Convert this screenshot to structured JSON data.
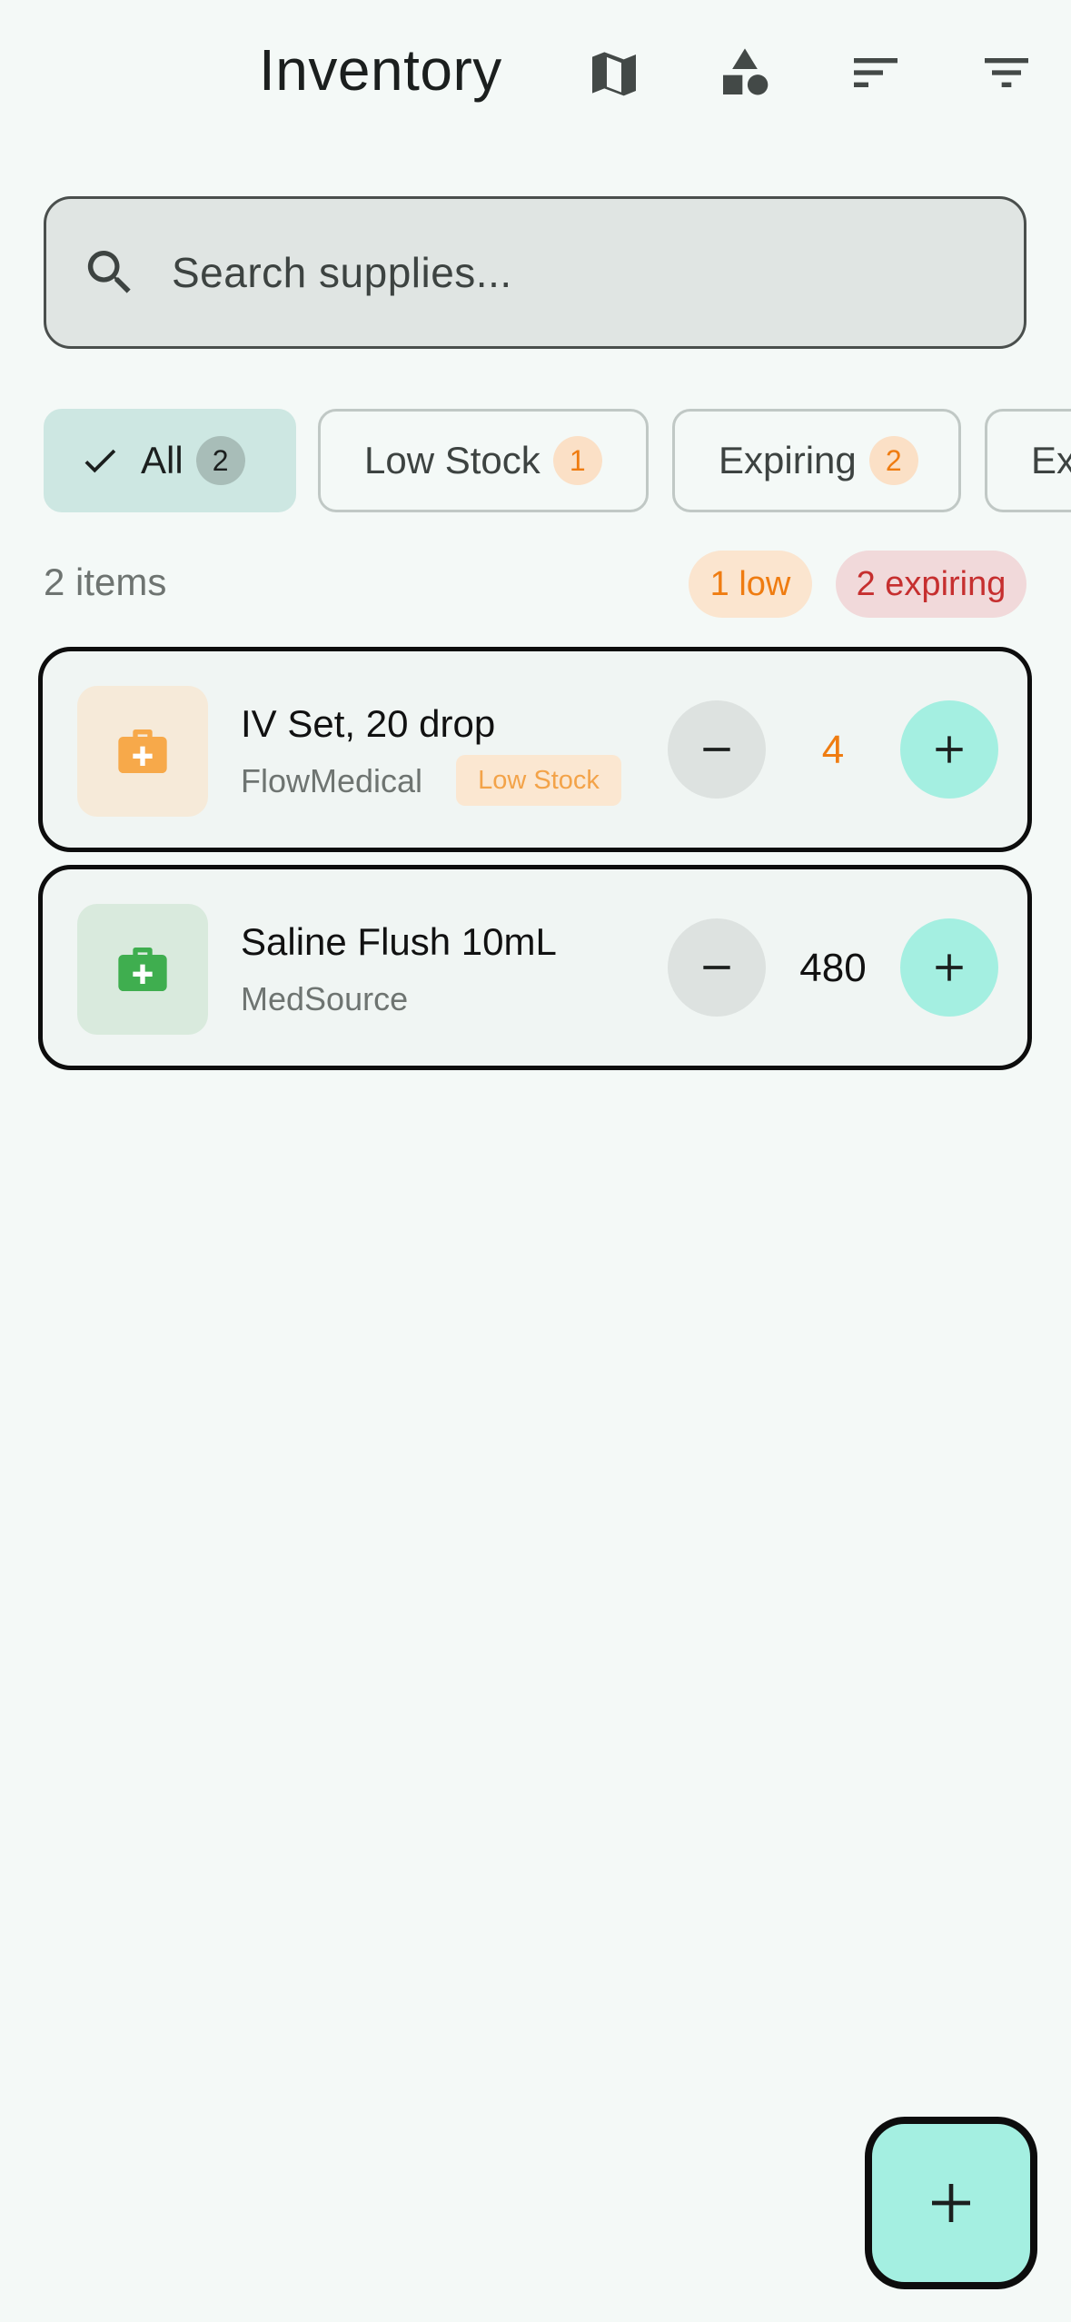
{
  "header": {
    "title": "Inventory",
    "icons": [
      "map-icon",
      "category-shapes-icon",
      "sort-icon",
      "filter-icon"
    ]
  },
  "search": {
    "placeholder": "Search supplies...",
    "value": ""
  },
  "filters": {
    "chips": [
      {
        "label": "All",
        "count": "2",
        "selected": true
      },
      {
        "label": "Low Stock",
        "count": "1",
        "selected": false
      },
      {
        "label": "Expiring",
        "count": "2",
        "selected": false
      },
      {
        "label": "Ex",
        "count": "",
        "selected": false
      }
    ]
  },
  "summary": {
    "item_count": "2 items",
    "low_label": "1 low",
    "expiring_label": "2 expiring"
  },
  "items": [
    {
      "name": "IV Set, 20 drop",
      "vendor": "FlowMedical",
      "tag": "Low Stock",
      "quantity": "4",
      "icon": "medical-kit-icon",
      "icon_color": "#f7a94a",
      "thumb_bg": "#f6ead9",
      "qty_color": "#ef7c11"
    },
    {
      "name": "Saline Flush 10mL",
      "vendor": "MedSource",
      "tag": "",
      "quantity": "480",
      "icon": "medical-kit-icon",
      "icon_color": "#3fae4f",
      "thumb_bg": "#d9eadd",
      "qty_color": "#111111"
    }
  ],
  "colors": {
    "accent": "#a4efe1",
    "selected_chip": "#cde7e2",
    "warning": "#ef7c11",
    "danger": "#c62f2f",
    "background": "#f4f9f7"
  },
  "fab": {
    "icon": "plus-icon"
  }
}
